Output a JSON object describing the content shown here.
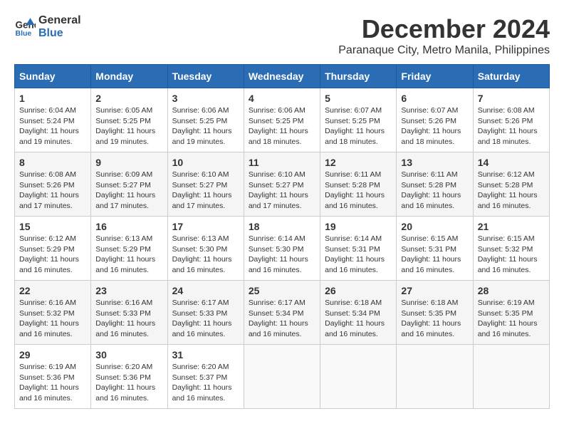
{
  "header": {
    "logo_line1": "General",
    "logo_line2": "Blue",
    "month": "December 2024",
    "location": "Paranaque City, Metro Manila, Philippines"
  },
  "weekdays": [
    "Sunday",
    "Monday",
    "Tuesday",
    "Wednesday",
    "Thursday",
    "Friday",
    "Saturday"
  ],
  "weeks": [
    [
      {
        "day": "1",
        "sunrise": "6:04 AM",
        "sunset": "5:24 PM",
        "daylight": "11 hours and 19 minutes."
      },
      {
        "day": "2",
        "sunrise": "6:05 AM",
        "sunset": "5:25 PM",
        "daylight": "11 hours and 19 minutes."
      },
      {
        "day": "3",
        "sunrise": "6:06 AM",
        "sunset": "5:25 PM",
        "daylight": "11 hours and 19 minutes."
      },
      {
        "day": "4",
        "sunrise": "6:06 AM",
        "sunset": "5:25 PM",
        "daylight": "11 hours and 18 minutes."
      },
      {
        "day": "5",
        "sunrise": "6:07 AM",
        "sunset": "5:25 PM",
        "daylight": "11 hours and 18 minutes."
      },
      {
        "day": "6",
        "sunrise": "6:07 AM",
        "sunset": "5:26 PM",
        "daylight": "11 hours and 18 minutes."
      },
      {
        "day": "7",
        "sunrise": "6:08 AM",
        "sunset": "5:26 PM",
        "daylight": "11 hours and 18 minutes."
      }
    ],
    [
      {
        "day": "8",
        "sunrise": "6:08 AM",
        "sunset": "5:26 PM",
        "daylight": "11 hours and 17 minutes."
      },
      {
        "day": "9",
        "sunrise": "6:09 AM",
        "sunset": "5:27 PM",
        "daylight": "11 hours and 17 minutes."
      },
      {
        "day": "10",
        "sunrise": "6:10 AM",
        "sunset": "5:27 PM",
        "daylight": "11 hours and 17 minutes."
      },
      {
        "day": "11",
        "sunrise": "6:10 AM",
        "sunset": "5:27 PM",
        "daylight": "11 hours and 17 minutes."
      },
      {
        "day": "12",
        "sunrise": "6:11 AM",
        "sunset": "5:28 PM",
        "daylight": "11 hours and 16 minutes."
      },
      {
        "day": "13",
        "sunrise": "6:11 AM",
        "sunset": "5:28 PM",
        "daylight": "11 hours and 16 minutes."
      },
      {
        "day": "14",
        "sunrise": "6:12 AM",
        "sunset": "5:28 PM",
        "daylight": "11 hours and 16 minutes."
      }
    ],
    [
      {
        "day": "15",
        "sunrise": "6:12 AM",
        "sunset": "5:29 PM",
        "daylight": "11 hours and 16 minutes."
      },
      {
        "day": "16",
        "sunrise": "6:13 AM",
        "sunset": "5:29 PM",
        "daylight": "11 hours and 16 minutes."
      },
      {
        "day": "17",
        "sunrise": "6:13 AM",
        "sunset": "5:30 PM",
        "daylight": "11 hours and 16 minutes."
      },
      {
        "day": "18",
        "sunrise": "6:14 AM",
        "sunset": "5:30 PM",
        "daylight": "11 hours and 16 minutes."
      },
      {
        "day": "19",
        "sunrise": "6:14 AM",
        "sunset": "5:31 PM",
        "daylight": "11 hours and 16 minutes."
      },
      {
        "day": "20",
        "sunrise": "6:15 AM",
        "sunset": "5:31 PM",
        "daylight": "11 hours and 16 minutes."
      },
      {
        "day": "21",
        "sunrise": "6:15 AM",
        "sunset": "5:32 PM",
        "daylight": "11 hours and 16 minutes."
      }
    ],
    [
      {
        "day": "22",
        "sunrise": "6:16 AM",
        "sunset": "5:32 PM",
        "daylight": "11 hours and 16 minutes."
      },
      {
        "day": "23",
        "sunrise": "6:16 AM",
        "sunset": "5:33 PM",
        "daylight": "11 hours and 16 minutes."
      },
      {
        "day": "24",
        "sunrise": "6:17 AM",
        "sunset": "5:33 PM",
        "daylight": "11 hours and 16 minutes."
      },
      {
        "day": "25",
        "sunrise": "6:17 AM",
        "sunset": "5:34 PM",
        "daylight": "11 hours and 16 minutes."
      },
      {
        "day": "26",
        "sunrise": "6:18 AM",
        "sunset": "5:34 PM",
        "daylight": "11 hours and 16 minutes."
      },
      {
        "day": "27",
        "sunrise": "6:18 AM",
        "sunset": "5:35 PM",
        "daylight": "11 hours and 16 minutes."
      },
      {
        "day": "28",
        "sunrise": "6:19 AM",
        "sunset": "5:35 PM",
        "daylight": "11 hours and 16 minutes."
      }
    ],
    [
      {
        "day": "29",
        "sunrise": "6:19 AM",
        "sunset": "5:36 PM",
        "daylight": "11 hours and 16 minutes."
      },
      {
        "day": "30",
        "sunrise": "6:20 AM",
        "sunset": "5:36 PM",
        "daylight": "11 hours and 16 minutes."
      },
      {
        "day": "31",
        "sunrise": "6:20 AM",
        "sunset": "5:37 PM",
        "daylight": "11 hours and 16 minutes."
      },
      null,
      null,
      null,
      null
    ]
  ]
}
